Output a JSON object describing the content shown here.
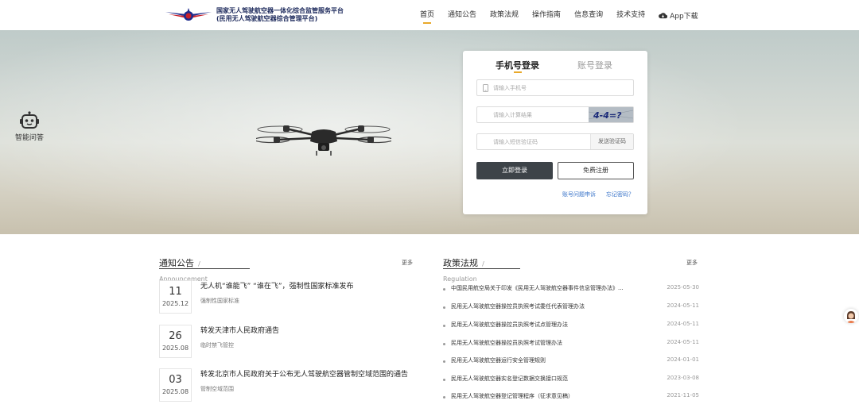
{
  "header": {
    "logo_line1": "国家无人驾驶航空器一体化综合监管服务平台",
    "logo_line2": "(民用无人驾驶航空器综合管理平台)",
    "nav": [
      {
        "label": "首页",
        "active": true
      },
      {
        "label": "通知公告",
        "active": false
      },
      {
        "label": "政策法规",
        "active": false
      },
      {
        "label": "操作指南",
        "active": false
      },
      {
        "label": "信息查询",
        "active": false
      },
      {
        "label": "技术支持",
        "active": false
      }
    ],
    "app_download": "App下载",
    "accent_color": "#e9a92b"
  },
  "assistant": {
    "label": "智能问答",
    "icon": "robot-icon"
  },
  "login": {
    "tab_phone": "手机号登录",
    "tab_account": "账号登录",
    "phone_placeholder": "请输入手机号",
    "calc_placeholder": "请输入计算结果",
    "captcha_text": "4-4=?",
    "sms_placeholder": "请输入短信验证码",
    "sms_button": "发送验证码",
    "login_button": "立即登录",
    "register_button": "免费注册",
    "appeal_link": "账号问题申诉",
    "forgot_link": "忘记密码？"
  },
  "notices": {
    "title": "通知公告",
    "subtitle": "Announcement",
    "more": "更多",
    "items": [
      {
        "day": "11",
        "ym": "2025.12",
        "title": "无人机“谁能飞” “谁在飞”，强制性国家标准发布",
        "tag": "强制性国家标准"
      },
      {
        "day": "26",
        "ym": "2025.08",
        "title": "转发天津市人民政府通告",
        "tag": "临时禁飞管控"
      },
      {
        "day": "03",
        "ym": "2025.08",
        "title": "转发北京市人民政府关于公布无人驾驶航空器管制空域范围的通告",
        "tag": "管制空域范围"
      }
    ]
  },
  "regulations": {
    "title": "政策法规",
    "subtitle": "Regulation",
    "more": "更多",
    "items": [
      {
        "text": "中国民用航空局关于印发《民用无人驾驶航空器事件信息管理办法》...",
        "date": "2025-05-30"
      },
      {
        "text": "民用无人驾驶航空器操控员执照考试委任代表管理办法",
        "date": "2024-05-11"
      },
      {
        "text": "民用无人驾驶航空器操控员执照考试点管理办法",
        "date": "2024-05-11"
      },
      {
        "text": "民用无人驾驶航空器操控员执照考试管理办法",
        "date": "2024-05-11"
      },
      {
        "text": "民用无人驾驶航空器运行安全管理规则",
        "date": "2024-01-01"
      },
      {
        "text": "民用无人驾驶航空器实名登记数据交换接口规范",
        "date": "2023-03-08"
      },
      {
        "text": "民用无人驾驶航空器登记管理程序（征求意见稿）",
        "date": "2021-11-05"
      }
    ]
  }
}
